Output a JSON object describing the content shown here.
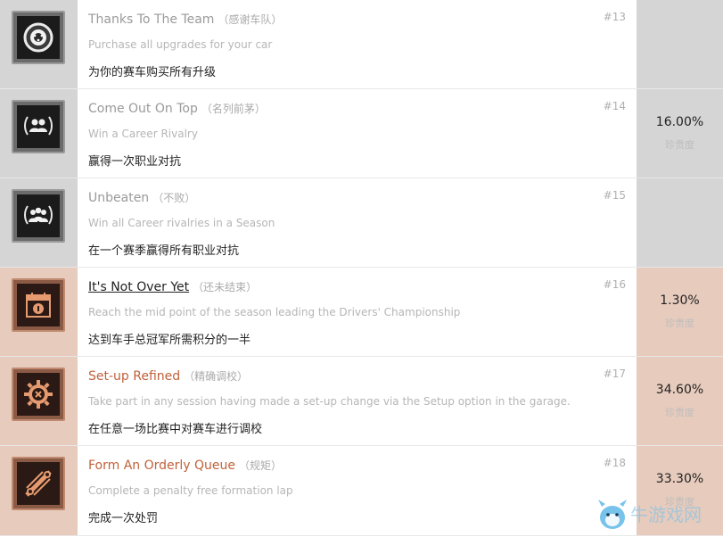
{
  "achievements": [
    {
      "title": "Thanks To The Team",
      "title_cn": "（感谢车队）",
      "description": "Purchase all upgrades for your car",
      "description_cn": "为你的赛车购买所有升级",
      "number": "#13",
      "icon": "wheel-icon"
    },
    {
      "title": "Come Out On Top",
      "title_cn": "（名列前茅）",
      "description": "Win a Career Rivalry",
      "description_cn": "赢得一次职业对抗",
      "number": "#14",
      "icon": "laurel-people-icon"
    },
    {
      "title": "Unbeaten",
      "title_cn": "（不败）",
      "description": "Win all Career rivalries in a Season",
      "description_cn": "在一个赛季赢得所有职业对抗",
      "number": "#15",
      "icon": "laurel-group-icon"
    },
    {
      "title": "It's Not Over Yet",
      "title_cn": "（还未结束）",
      "description": "Reach the mid point of the season leading the Drivers' Championship",
      "description_cn": "达到车手总冠军所需积分的一半",
      "number": "#16",
      "icon": "calendar-icon"
    },
    {
      "title": "Set-up Refined",
      "title_cn": "（精确调校）",
      "description": "Take part in any session having made a set-up change via the Setup option in the garage.",
      "description_cn": "在任意一场比赛中对赛车进行调校",
      "number": "#17",
      "icon": "gear-icon"
    },
    {
      "title": "Form An Orderly Queue",
      "title_cn": "（规矩）",
      "description": "Complete a penalty free formation lap",
      "description_cn": "完成一次处罚",
      "number": "#18",
      "icon": "wrench-icon"
    }
  ],
  "rarity": [
    {
      "percent": "16.00%",
      "label": "珍贵度"
    },
    {
      "percent": "1.30%",
      "label": "珍贵度"
    },
    {
      "percent": "34.60%",
      "label": "珍贵度"
    },
    {
      "percent": "33.30%",
      "label": "珍贵度"
    }
  ],
  "watermark": {
    "text": "牛游戏网"
  },
  "colors": {
    "gray_band": "#d5d5d5",
    "peach_band": "#e7cbbd",
    "link_orange": "#c0613a"
  }
}
